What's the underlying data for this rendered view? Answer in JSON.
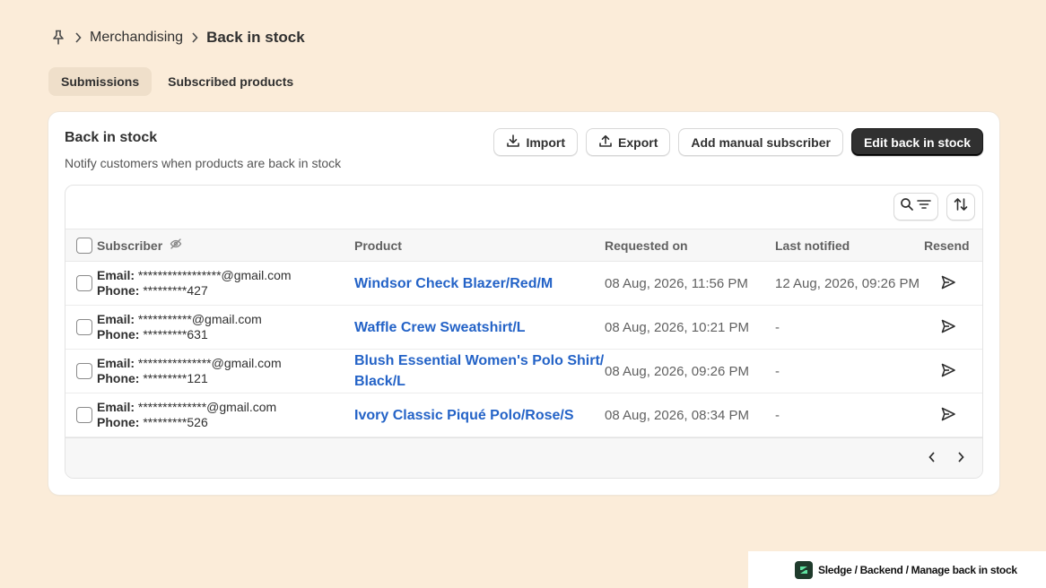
{
  "breadcrumb": {
    "icon": "pin-icon",
    "parent": "Merchandising",
    "current": "Back in stock"
  },
  "tabs": [
    {
      "label": "Submissions",
      "active": true
    },
    {
      "label": "Subscribed products",
      "active": false
    }
  ],
  "card": {
    "title": "Back in stock",
    "subtitle": "Notify customers when products are back in stock"
  },
  "actions": {
    "import_label": "Import",
    "export_label": "Export",
    "add_label": "Add manual subscriber",
    "edit_label": "Edit back in stock"
  },
  "table": {
    "headers": {
      "subscriber": "Subscriber",
      "product": "Product",
      "requested": "Requested on",
      "notified": "Last notified",
      "resend": "Resend"
    },
    "rows": [
      {
        "email_label": "Email:",
        "email": "*****************@gmail.com",
        "phone_label": "Phone:",
        "phone": "*********427",
        "product": "Windsor Check Blazer/Red/M",
        "requested": "08 Aug, 2026, 11:56 PM",
        "notified": "12 Aug, 2026, 09:26 PM"
      },
      {
        "email_label": "Email:",
        "email": "***********@gmail.com",
        "phone_label": "Phone:",
        "phone": "*********631",
        "product": "Waffle Crew Sweatshirt/L",
        "requested": "08 Aug, 2026, 10:21 PM",
        "notified": "-"
      },
      {
        "email_label": "Email:",
        "email": "***************@gmail.com",
        "phone_label": "Phone:",
        "phone": "*********121",
        "product_line1": "Blush Essential Women's Polo Shirt/",
        "product_line2": "Black/L",
        "requested": "08 Aug, 2026, 09:26 PM",
        "notified": "-"
      },
      {
        "email_label": "Email:",
        "email": "**************@gmail.com",
        "phone_label": "Phone:",
        "phone": "*********526",
        "product": "Ivory Classic Piqué Polo/Rose/S",
        "requested": "08 Aug, 2026, 08:34 PM",
        "notified": "-"
      }
    ]
  },
  "watermark": {
    "text": "Sledge / Backend / Manage back in stock"
  },
  "colors": {
    "background": "#fbecd9",
    "link": "#2463c7",
    "primary_button": "#303030"
  }
}
